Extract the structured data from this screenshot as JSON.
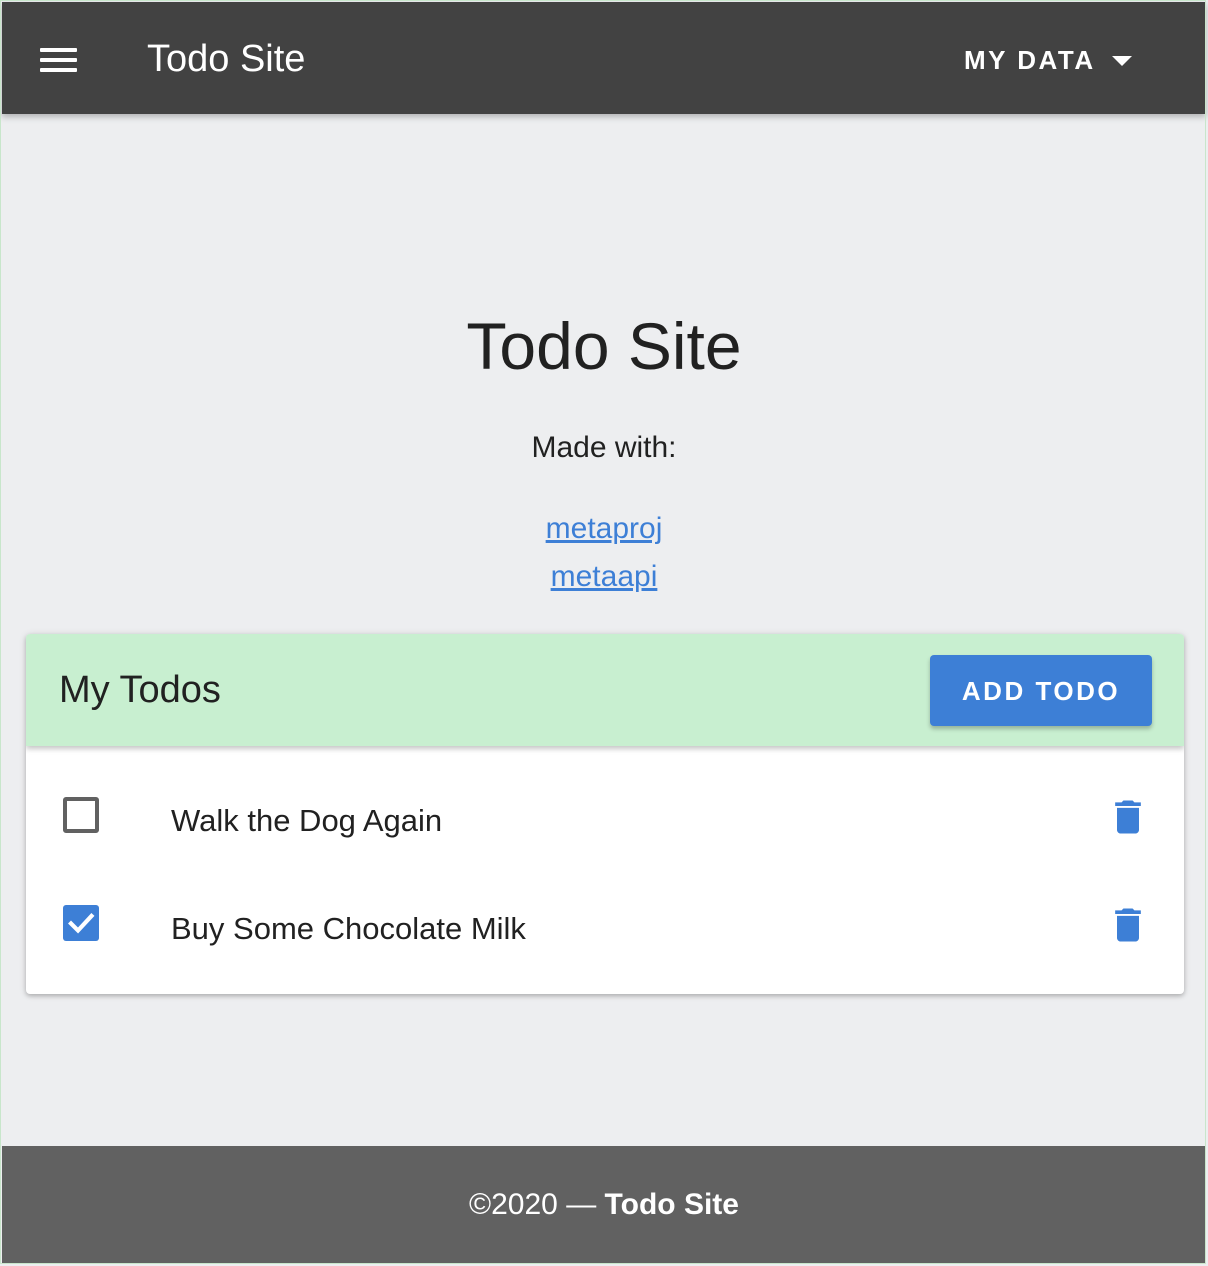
{
  "appbar": {
    "menu_icon": "hamburger-menu-icon",
    "title": "Todo Site",
    "menu_label": "MY DATA",
    "menu_icon_dropdown": "caret-down-icon"
  },
  "hero": {
    "title": "Todo Site",
    "made_with": "Made with:",
    "links": [
      "metaproj",
      "metaapi"
    ]
  },
  "todos_card": {
    "title": "My Todos",
    "add_button_label": "ADD TODO",
    "items": [
      {
        "label": "Walk the Dog Again",
        "checked": false,
        "delete_icon": "trash-icon"
      },
      {
        "label": "Buy Some Chocolate Milk",
        "checked": true,
        "delete_icon": "trash-icon"
      }
    ]
  },
  "footer": {
    "copyright": "©2020 — ",
    "site_name": "Todo Site"
  },
  "colors": {
    "appbar": "#424242",
    "accent": "#3d7fd6",
    "card_header": "#c8efd0",
    "footer": "#616161",
    "page_bg": "#edeef0"
  }
}
